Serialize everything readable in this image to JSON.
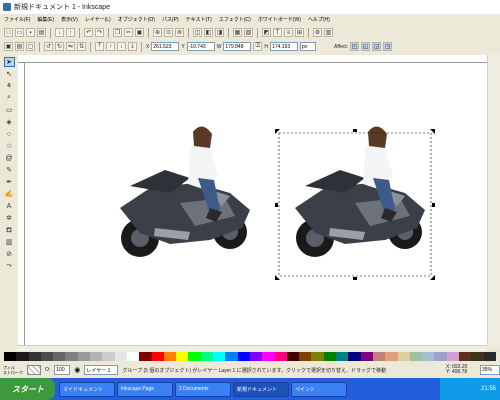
{
  "window": {
    "title": "新規ドキュメント 1 - Inkscape"
  },
  "menu": [
    "ファイル(F)",
    "編集(E)",
    "表示(V)",
    "レイヤー(L)",
    "オブジェクト(O)",
    "パス(P)",
    "テキスト(T)",
    "エフェクト(C)",
    "ホワイトボード(W)",
    "ヘルプ(H)"
  ],
  "toolbar2": {
    "x_label": "X",
    "x_value": "261.523",
    "y_label": "Y",
    "y_value": "-10.743",
    "w_label": "W",
    "w_value": "179.848",
    "h_label": "H",
    "h_value": "174.193",
    "unit": "px",
    "affect_label": "Affect:"
  },
  "status": {
    "fill_label": "フィル",
    "stroke_label": "ストローク",
    "opacity_label": "O:",
    "opacity_value": "100",
    "layer_value": "レイヤー 1",
    "message": "グループ (5 個のオブジェクト) がレイヤー Layer 1 に選択されています。クリックで選択を切り替え、ドラッグで移動",
    "coord_x": "X: 693.20",
    "coord_y": "Y: 408.78",
    "zoom": "35%"
  },
  "taskbar": {
    "start_label": "スタート",
    "items": [
      "マイドキュメント",
      "Inkscape Page",
      "2 Documents",
      "新規ドキュメント",
      "ペイント"
    ],
    "clock": "21:55"
  },
  "colors": {
    "titlebar": "#ffffff",
    "taskbar": "#245edb",
    "start": "#3c9a3c",
    "selection": "#000000"
  }
}
